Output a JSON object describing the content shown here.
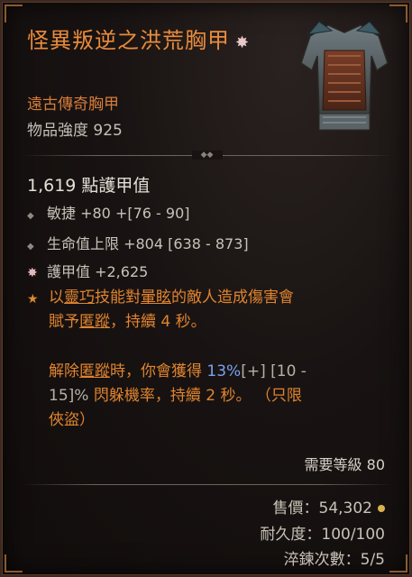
{
  "item": {
    "title": "怪異叛逆之洪荒胸甲",
    "subtype": "遠古傳奇胸甲",
    "power_label": "物品強度 925",
    "armor_label": "1,619 點護甲值"
  },
  "affixes": [
    {
      "text": "敏捷 +80 +[76 - 90]"
    },
    {
      "text": "生命值上限 +804 [638 - 873]"
    },
    {
      "text": "護甲值 +2,625"
    }
  ],
  "legendary": {
    "line1a": "以",
    "skill1": "靈巧",
    "line1b": "技能對",
    "skill2": "暈眩",
    "line1c": "的敵人造成傷害會",
    "line2a": "賦予",
    "skill3": "匿蹤",
    "line2b": "，持續 4 秒。",
    "p2a": "解除",
    "skill4": "匿蹤",
    "p2b": "時，你會獲得 ",
    "value": "13%",
    "range1": "[+] [10 -",
    "p2c": "15]%",
    "p2d": " 閃躲機率，持續 2 秒。 （只限",
    "p2e": "俠盜）"
  },
  "footer": {
    "required_level": "需要等級 80",
    "sell_price": "售價：54,302",
    "durability": "耐久度：100/100",
    "quench": "淬鍊次數：5/5"
  },
  "colors": {
    "title": "#e98b3c",
    "legendary": "#e0842f",
    "value_blue": "#7aa1f0",
    "gold": "#d8b24c"
  }
}
